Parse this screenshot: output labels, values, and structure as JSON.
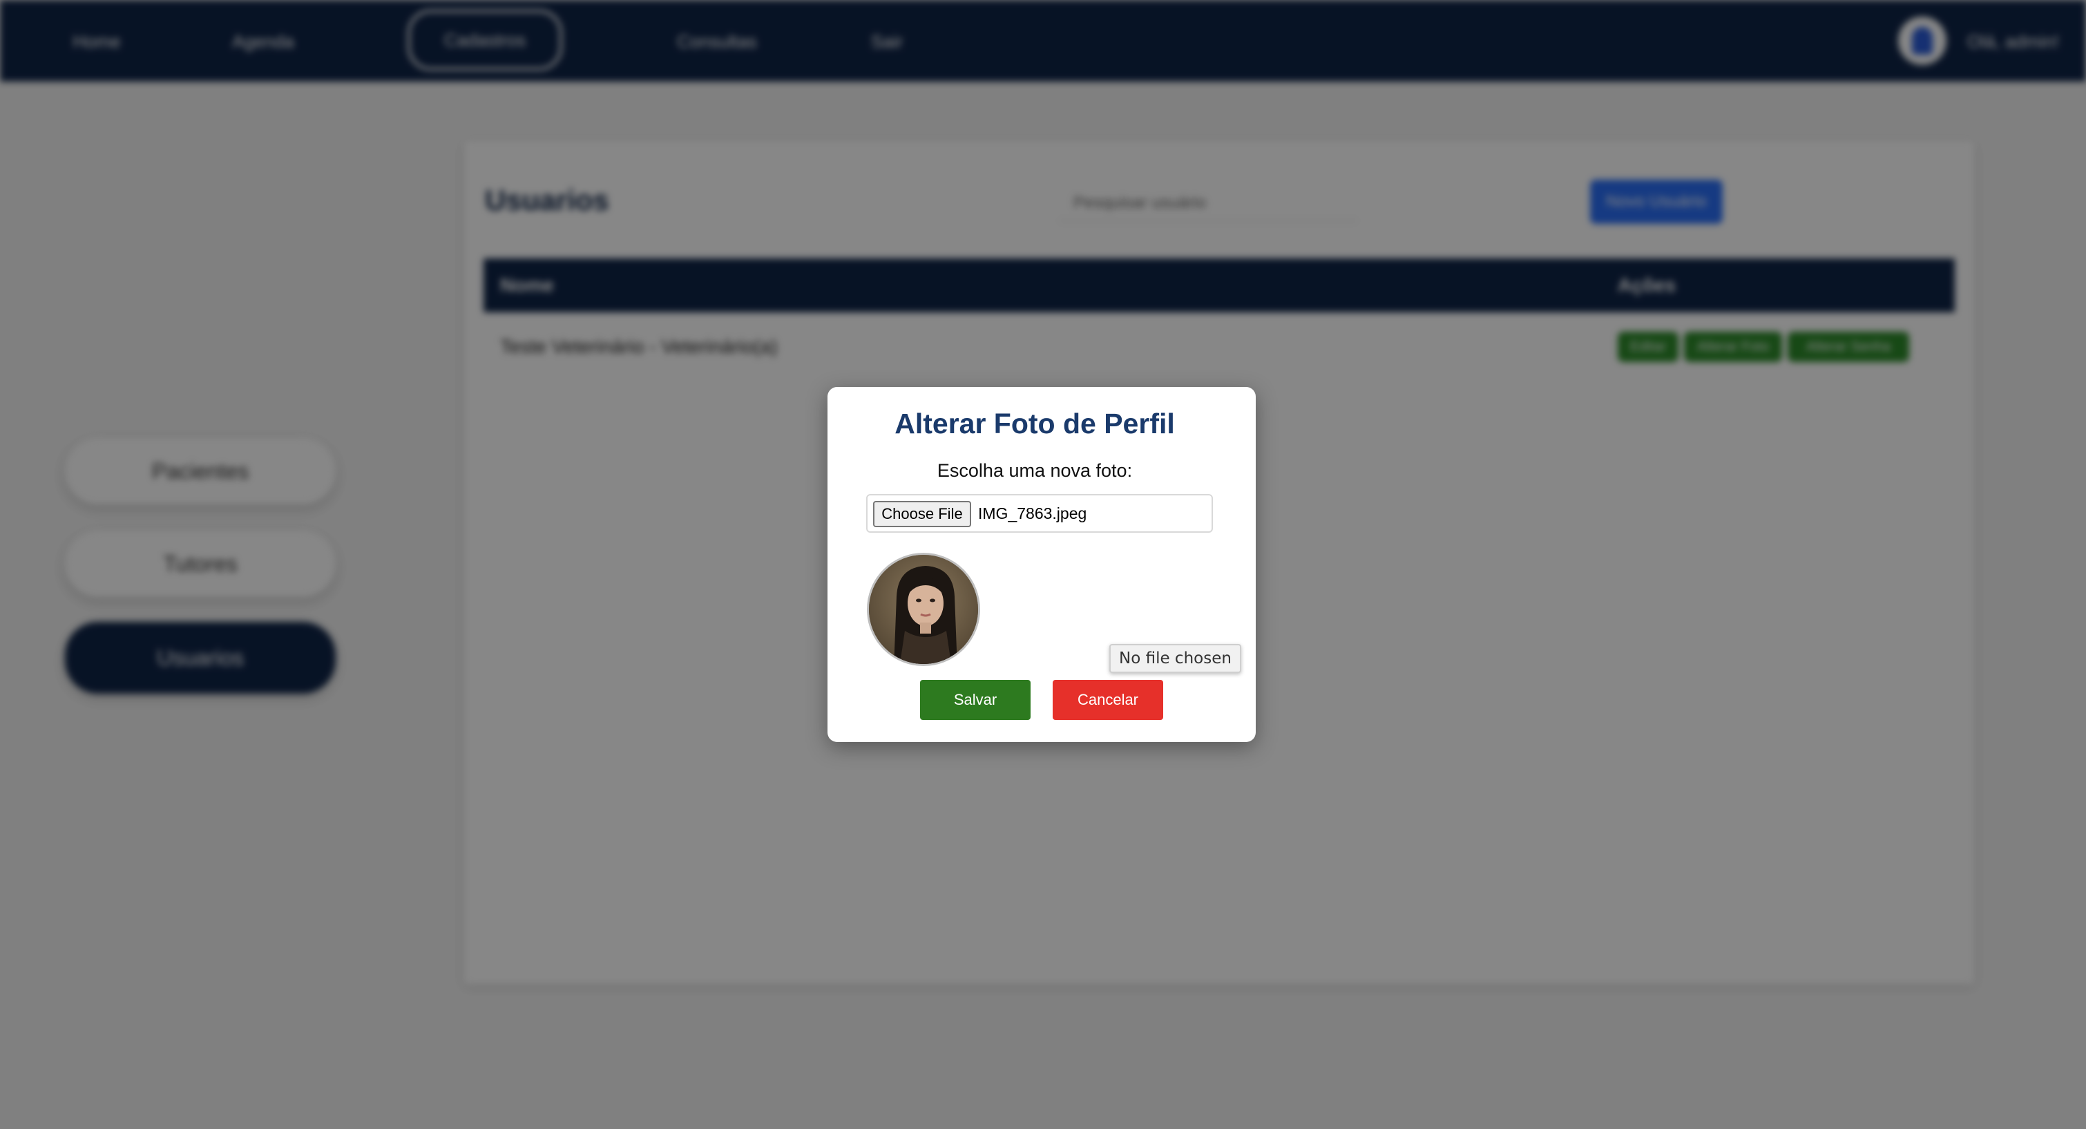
{
  "topbar": {
    "nav": [
      {
        "label": "Home"
      },
      {
        "label": "Agenda"
      },
      {
        "label": "Cadastros"
      },
      {
        "label": "Consultas"
      },
      {
        "label": "Sair"
      }
    ],
    "greeting": "Olá, admin!"
  },
  "sidebar": {
    "items": [
      {
        "label": "Pacientes"
      },
      {
        "label": "Tutores"
      },
      {
        "label": "Usuarios"
      }
    ]
  },
  "main": {
    "title": "Usuarios",
    "search_placeholder": "Pesquisar usuário",
    "new_button": "Novo Usuário",
    "table": {
      "columns": [
        "Nome",
        "Ações"
      ],
      "rows": [
        {
          "name": "Teste Veterinário - Veterinário(a)",
          "actions": [
            "Editar",
            "Alterar Foto",
            "Alterar Senha"
          ]
        }
      ]
    }
  },
  "modal": {
    "title": "Alterar Foto de Perfil",
    "label": "Escolha uma nova foto:",
    "choose_button": "Choose File",
    "file_name": "IMG_7863.jpeg",
    "tooltip": "No file chosen",
    "save_button": "Salvar",
    "cancel_button": "Cancelar"
  },
  "colors": {
    "navy": "#0f2447",
    "title_blue": "#1a3a6b",
    "save_green": "#2d7a1f",
    "cancel_red": "#e6302a",
    "action_green": "#2d8a2a",
    "new_blue": "#2a6ef5"
  }
}
